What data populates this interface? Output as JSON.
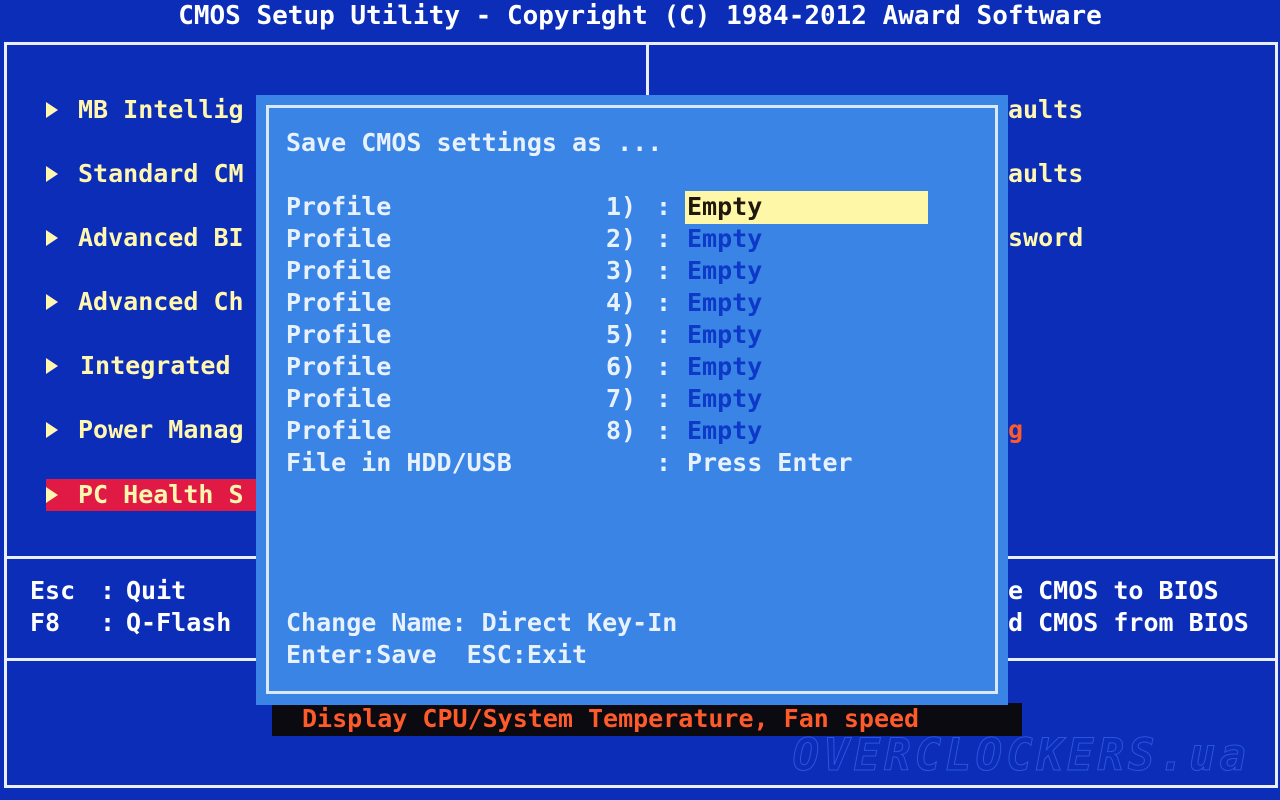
{
  "window": {
    "title": "CMOS Setup Utility - Copyright (C) 1984-2012 Award Software"
  },
  "left_menu": [
    {
      "label": "MB Intellig"
    },
    {
      "label": "Standard CM"
    },
    {
      "label": "Advanced BI"
    },
    {
      "label": "Advanced Ch"
    },
    {
      "label": "Integrated"
    },
    {
      "label": "Power Manag"
    },
    {
      "label": "PC Health S",
      "selected": true
    }
  ],
  "right_menu_fragments": [
    {
      "label": "aults",
      "color": "#fff7b0"
    },
    {
      "label": "aults",
      "color": "#fff7b0"
    },
    {
      "label": "sword",
      "color": "#fff7b0"
    },
    {
      "label": "g",
      "color": "#ff5a2a"
    }
  ],
  "hotkeys_left": [
    {
      "key": "Esc",
      "sep": ":",
      "action": "Quit"
    },
    {
      "key": "F8",
      "sep": ":",
      "action": "Q-Flash"
    }
  ],
  "hotkeys_right": [
    {
      "text": "e CMOS to BIOS"
    },
    {
      "text": "d CMOS from BIOS"
    }
  ],
  "status_bar": {
    "text": "Display CPU/System Temperature, Fan speed"
  },
  "dialog": {
    "heading": "Save CMOS settings as ...",
    "profiles": [
      {
        "label": "Profile",
        "num": "1)",
        "sep": ":",
        "value": "Empty",
        "selected": true
      },
      {
        "label": "Profile",
        "num": "2)",
        "sep": ":",
        "value": "Empty"
      },
      {
        "label": "Profile",
        "num": "3)",
        "sep": ":",
        "value": "Empty"
      },
      {
        "label": "Profile",
        "num": "4)",
        "sep": ":",
        "value": "Empty"
      },
      {
        "label": "Profile",
        "num": "5)",
        "sep": ":",
        "value": "Empty"
      },
      {
        "label": "Profile",
        "num": "6)",
        "sep": ":",
        "value": "Empty"
      },
      {
        "label": "Profile",
        "num": "7)",
        "sep": ":",
        "value": "Empty"
      },
      {
        "label": "Profile",
        "num": "8)",
        "sep": ":",
        "value": "Empty"
      }
    ],
    "file_row": {
      "label": "File in HDD/USB",
      "sep": ":",
      "value": "Press Enter"
    },
    "help_line1": "Change Name: Direct Key-In",
    "help_line2": "Enter:Save  ESC:Exit"
  },
  "watermark": "OVERCLOCKERS.ua",
  "colors": {
    "background": "#0b2db8",
    "menu_text": "#fff7b0",
    "selected_bg": "#e01a45",
    "dialog_bg": "#3a84e6",
    "dialog_value_blue": "#0d39c8",
    "highlight_bg": "#fff7a8",
    "status_text": "#ff5a2a"
  },
  "icons": {
    "menu_arrow": "triangle-right-icon"
  }
}
